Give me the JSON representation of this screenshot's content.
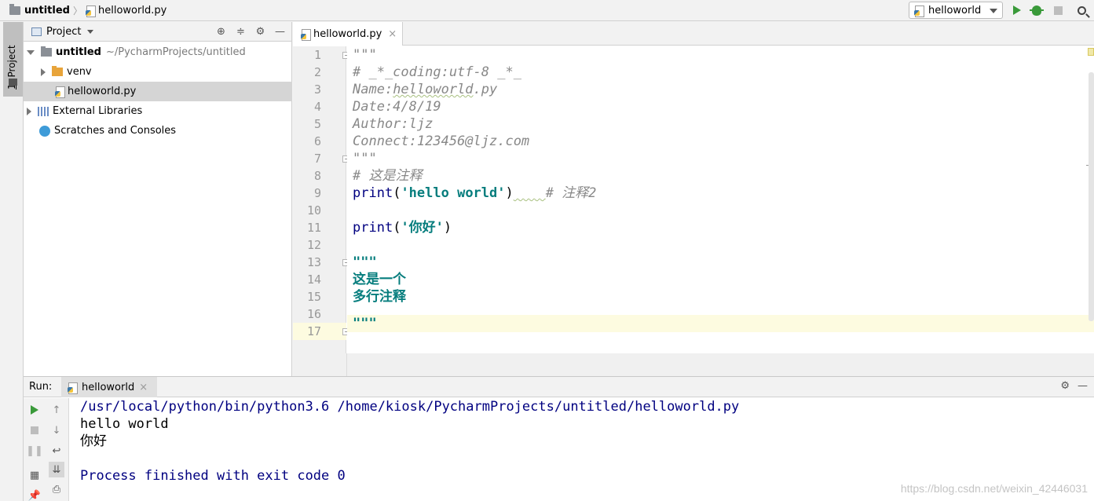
{
  "breadcrumb": {
    "project": "untitled",
    "file": "helloworld.py"
  },
  "toolbar": {
    "run_config": "helloworld"
  },
  "left_stripe": {
    "project_tab_number": "1",
    "project_tab_label": "Project"
  },
  "project_panel": {
    "title": "Project",
    "root_name": "untitled",
    "root_path": "~/PycharmProjects/untitled",
    "items": [
      {
        "label": "venv"
      },
      {
        "label": "helloworld.py"
      },
      {
        "label": "External Libraries"
      },
      {
        "label": "Scratches and Consoles"
      }
    ]
  },
  "editor": {
    "tab_label": "helloworld.py",
    "tab_close": "×",
    "line_numbers": [
      "1",
      "2",
      "3",
      "4",
      "5",
      "6",
      "7",
      "8",
      "9",
      "10",
      "11",
      "12",
      "13",
      "14",
      "15",
      "16",
      "17"
    ],
    "current_line": 17,
    "lines": {
      "l1": "\"\"\"",
      "l2": "# _*_coding:utf-8 _*_",
      "l3a": "Name:",
      "l3b": "helloworld",
      "l3c": ".py",
      "l4": "Date:4/8/19",
      "l5": "Author:ljz",
      "l6": "Connect:123456@ljz.com",
      "l7": "\"\"\"",
      "l8": "# 这是注释",
      "l9_fn": "print",
      "l9_open": "(",
      "l9_str": "'hello world'",
      "l9_close": ")",
      "l9_comment": "# 注释2",
      "l11_fn": "print",
      "l11_open": "(",
      "l11_str": "'你好'",
      "l11_close": ")",
      "l13": "\"\"\"",
      "l14": "这是一个",
      "l15": "多行注释",
      "l17": "\"\"\""
    }
  },
  "run_panel": {
    "label": "Run:",
    "tab_label": "helloworld",
    "tab_close": "×",
    "console": {
      "command": "/usr/local/python/bin/python3.6 /home/kiosk/PycharmProjects/untitled/helloworld.py",
      "out1": "hello world",
      "out2": "你好",
      "finished": "Process finished with exit code 0"
    }
  },
  "watermark": "https://blog.csdn.net/weixin_42446031"
}
